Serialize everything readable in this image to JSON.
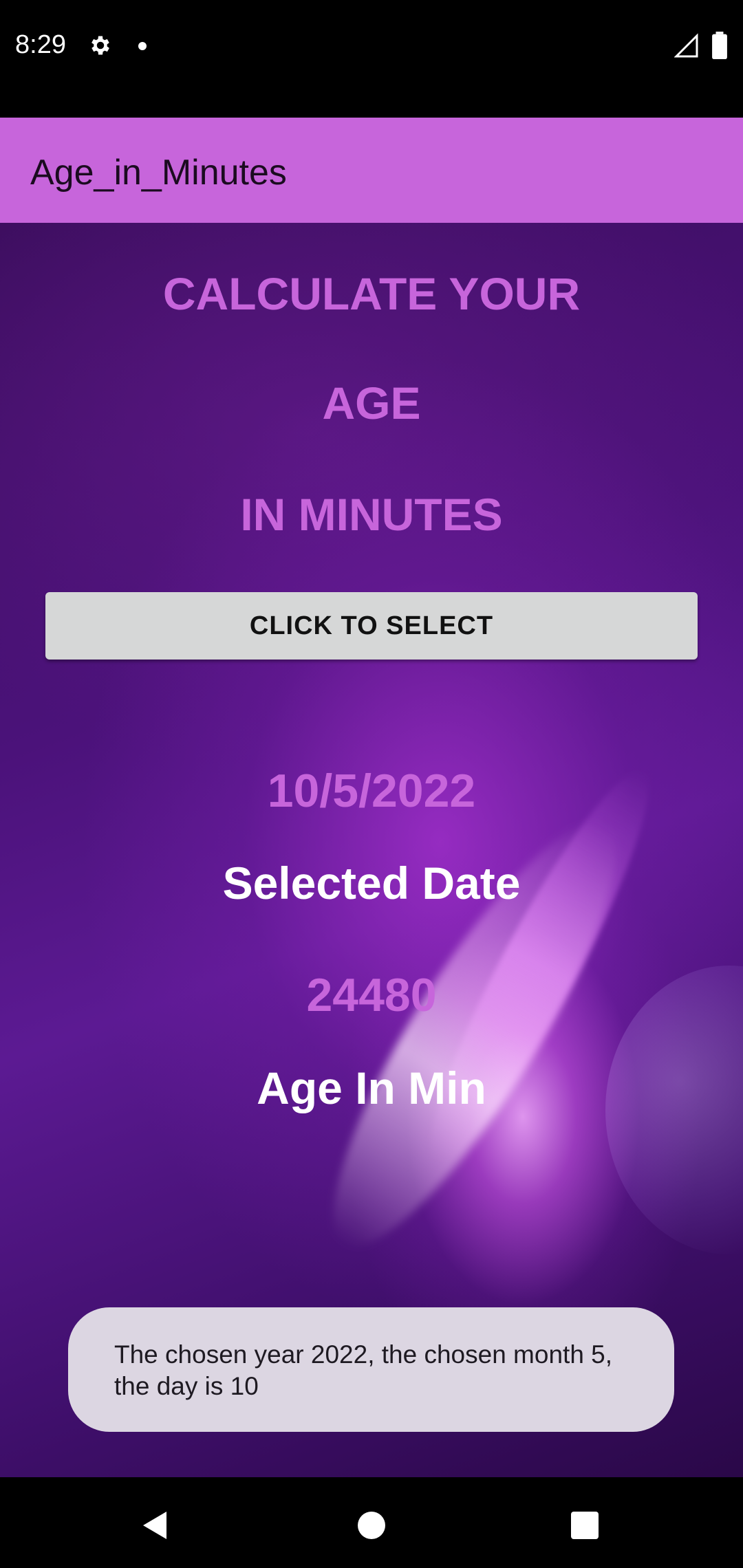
{
  "status_bar": {
    "time": "8:29",
    "icons": [
      "gear-icon",
      "notification-dot-icon",
      "cell-signal-icon",
      "battery-icon"
    ]
  },
  "app_bar": {
    "title": "Age_in_Minutes",
    "color": "#c765db"
  },
  "main": {
    "headline_lines": [
      "CALCULATE YOUR",
      "AGE",
      "IN MINUTES"
    ],
    "select_button_label": "CLICK TO SELECT",
    "selected_date_value": "10/5/2022",
    "selected_date_label": "Selected Date",
    "age_value": "24480",
    "age_label": "Age In Min",
    "accent_color": "#c765db"
  },
  "toast": {
    "message": "The chosen year 2022, the chosen month 5, the day is 10"
  },
  "nav_bar": {
    "icons": [
      "back-icon",
      "home-icon",
      "recents-icon"
    ]
  }
}
